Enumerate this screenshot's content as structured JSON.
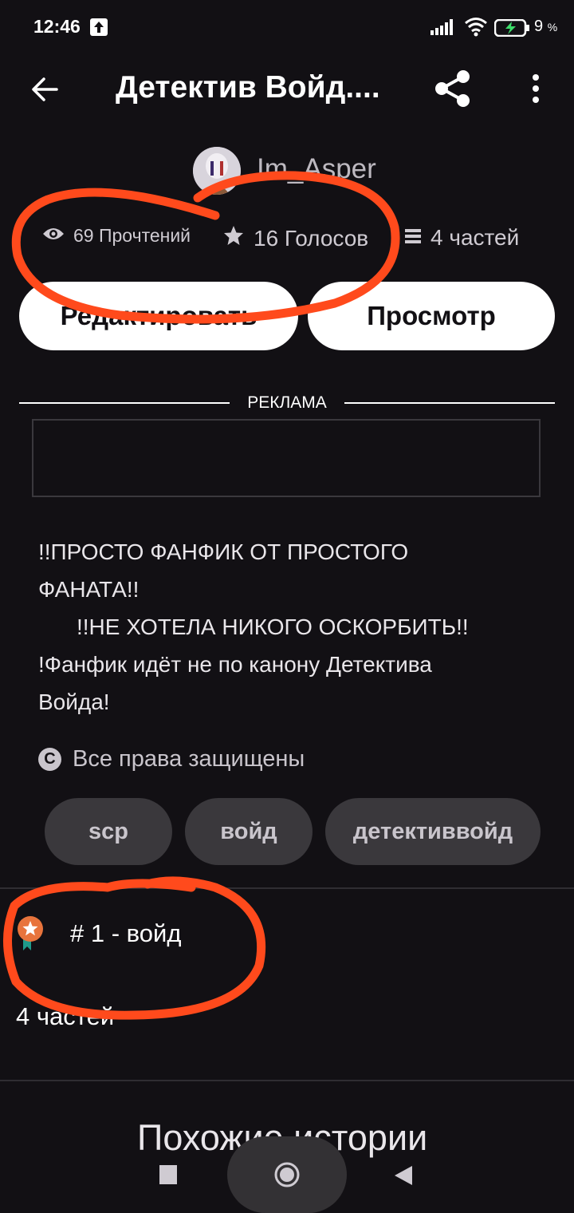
{
  "status_bar": {
    "time": "12:46",
    "battery_percent": "9",
    "battery_unit": "%"
  },
  "header": {
    "title": "Детектив Войд....",
    "back_icon": "back-arrow-icon",
    "share_icon": "share-icon",
    "more_icon": "more-vert-icon"
  },
  "author": {
    "name": "Im_Asper"
  },
  "stats": {
    "reads": "69 Прочтений",
    "votes": "16 Голосов",
    "parts": "4 частей"
  },
  "buttons": {
    "edit": "Редактировать",
    "preview": "Просмотр"
  },
  "ad": {
    "label": "РЕКЛАМА"
  },
  "description": {
    "lines": [
      "!!ПРОСТО ФАНФИК ОТ ПРОСТОГО",
      "ФАНАТА!!",
      "!!НЕ ХОТЕЛА НИКОГО ОСКОРБИТЬ!!",
      "!Фанфик идёт не по канону Детектива",
      "Войда!"
    ]
  },
  "copyright": {
    "icon_glyph": "C",
    "text": "Все права защищены"
  },
  "tags": [
    "scp",
    "войд",
    "детективвойд"
  ],
  "ranking": {
    "text": "# 1 - войд"
  },
  "parts_label": "4 частей",
  "similar": {
    "title": "Похожие истории"
  },
  "colors": {
    "background": "#121014",
    "annotation": "#ff4a1c",
    "button": "#ffffff",
    "tag": "#3a383c"
  }
}
